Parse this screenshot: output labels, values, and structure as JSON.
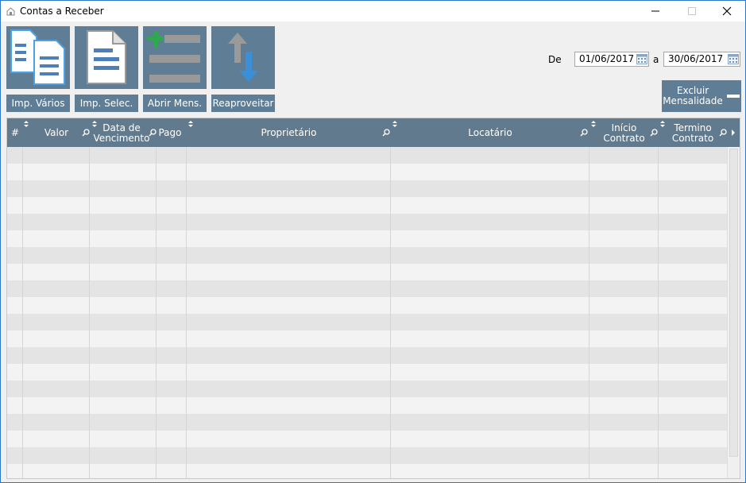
{
  "window": {
    "title": "Contas a Receber",
    "icons": {
      "app": "home-icon",
      "minimize": "minimize-icon",
      "maximize": "maximize-icon",
      "close": "close-icon"
    }
  },
  "toolbar": {
    "buttons": [
      {
        "label": "Imp. Vários",
        "icon": "documents-multiple-icon"
      },
      {
        "label": "Imp. Selec.",
        "icon": "document-single-icon"
      },
      {
        "label": "Abrir Mens.",
        "icon": "add-list-icon"
      },
      {
        "label": "Reaproveitar",
        "icon": "swap-arrows-icon"
      }
    ]
  },
  "filter": {
    "from_label": "De",
    "from_date": "01/06/2017",
    "to_label": "a",
    "to_date": "30/06/2017",
    "calendar_icon": "calendar-icon"
  },
  "excluir": {
    "line1": "Excluir",
    "line2": "Mensalidade",
    "icon": "minus-icon"
  },
  "grid": {
    "columns": [
      {
        "line1": "#",
        "line2": ""
      },
      {
        "line1": "Valor",
        "line2": ""
      },
      {
        "line1": "Data de",
        "line2": "Vencimento"
      },
      {
        "line1": "Pago",
        "line2": ""
      },
      {
        "line1": "Proprietário",
        "line2": ""
      },
      {
        "line1": "Locatário",
        "line2": ""
      },
      {
        "line1": "Início",
        "line2": "Contrato"
      },
      {
        "line1": "Termino",
        "line2": "Contrato"
      }
    ],
    "rows": []
  },
  "colors": {
    "accent": "#5f7d94",
    "header": "#617a8e",
    "row_even": "#e4e4e4",
    "row_odd": "#f3f3f3"
  }
}
